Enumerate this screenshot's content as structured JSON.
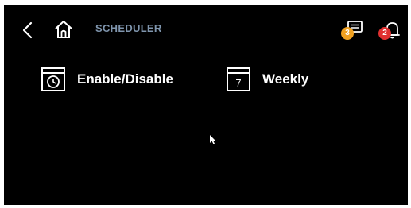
{
  "header": {
    "title": "SCHEDULER",
    "back_icon": "chevron-left-icon",
    "home_icon": "home-icon",
    "messages_icon": "message-icon",
    "messages_count": "3",
    "alarms_icon": "bell-icon",
    "alarms_count": "2"
  },
  "colors": {
    "background": "#000000",
    "title": "#7f95ad",
    "messages_badge": "#f0a020",
    "alarms_badge": "#e03030"
  },
  "tiles": [
    {
      "label": "Enable/Disable",
      "icon": "clock-icon"
    },
    {
      "label": "Weekly",
      "icon": "calendar-icon",
      "icon_text": "7"
    }
  ]
}
